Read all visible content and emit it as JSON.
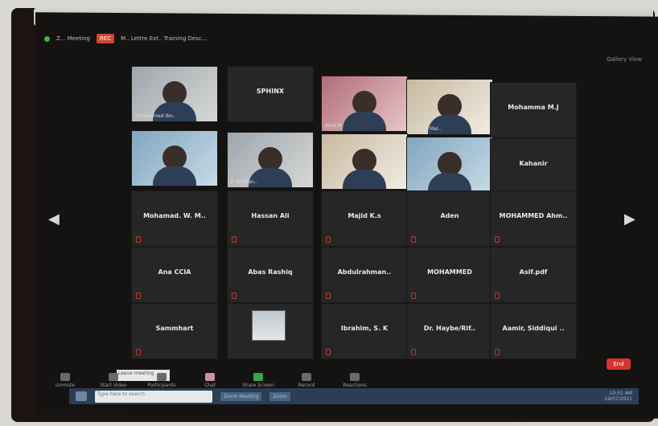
{
  "window": {
    "title": "Z... Meeting",
    "meeting_label": "M.. Lettre Ext.. Training Desc..."
  },
  "toolbar_view": "Gallery View",
  "recording_badge": "REC",
  "tiles": [
    {
      "name": "Mohammed Ibn..",
      "video": true
    },
    {
      "name": "SPHINX",
      "video": false
    },
    {
      "name": "Abid M",
      "video": true
    },
    {
      "name": "P. Brian Mal..",
      "video": true
    },
    {
      "name": "Mohamma M.J",
      "video": false
    },
    {
      "name": "",
      "video": true
    },
    {
      "name": "P. Whelan..",
      "video": true
    },
    {
      "name": "",
      "video": true
    },
    {
      "name": "",
      "video": true
    },
    {
      "name": "Kahanir",
      "video": false
    },
    {
      "name": "Mohamad. W. M..",
      "video": false
    },
    {
      "name": "Hassan Ali",
      "video": false
    },
    {
      "name": "Majid K.s",
      "video": false
    },
    {
      "name": "Aden",
      "video": false
    },
    {
      "name": "MOHAMMED Ahm..",
      "video": false
    },
    {
      "name": "Ana CCIA",
      "video": false
    },
    {
      "name": "Abas Rashiq",
      "video": false
    },
    {
      "name": "Abdulrahman..",
      "video": false
    },
    {
      "name": "MOHAMMED",
      "video": false
    },
    {
      "name": "Asif.pdf",
      "video": false
    },
    {
      "name": "Sammhart",
      "video": false
    },
    {
      "name": "",
      "video": true
    },
    {
      "name": "Ibrahim, S. K",
      "video": false
    },
    {
      "name": "Dr. Haybe/Rif..",
      "video": false
    },
    {
      "name": "Aamir, Siddiqui ..",
      "video": false
    }
  ],
  "toolbar": [
    {
      "label": "Unmute",
      "icon": "mic-icon"
    },
    {
      "label": "Start Video",
      "icon": "camera-icon"
    },
    {
      "label": "Participants",
      "icon": "people-icon"
    },
    {
      "label": "Chat",
      "icon": "chat-icon"
    },
    {
      "label": "Share Screen",
      "icon": "share-screen-icon"
    },
    {
      "label": "Record",
      "icon": "record-icon"
    },
    {
      "label": "Reactions",
      "icon": "reaction-icon"
    }
  ],
  "end_label": "End",
  "tooltip": "Leave meeting",
  "taskbar": {
    "search_placeholder": "Type here to search",
    "items": [
      "Zoom Meeting",
      "Zoom"
    ],
    "time": "10:51 AM",
    "date": "19/07/2021"
  },
  "colors": {
    "end_button": "#d3352f",
    "taskbar": "#2b3e55",
    "share_screen": "#3da44e"
  }
}
